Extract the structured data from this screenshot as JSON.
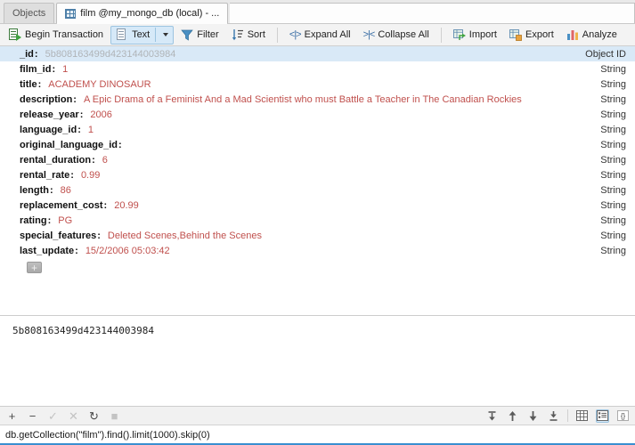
{
  "tabs": {
    "items": [
      {
        "label": "Objects",
        "icon": null,
        "active": false
      },
      {
        "label": "film @my_mongo_db (local) - ...",
        "icon": "table-icon",
        "active": true
      }
    ]
  },
  "toolbar": {
    "begin_transaction": "Begin Transaction",
    "text_mode": "Text",
    "filter": "Filter",
    "sort": "Sort",
    "expand_all": "Expand All",
    "collapse_all": "Collapse All",
    "import": "Import",
    "export": "Export",
    "analyze": "Analyze",
    "icons": {
      "begin_transaction": "transaction-icon",
      "text_mode": "document-text-icon",
      "text_dropdown": "chevron-down-icon",
      "filter": "funnel-icon",
      "sort": "sort-icon",
      "expand_all": "expand-all-icon",
      "collapse_all": "collapse-all-icon",
      "import": "import-icon",
      "export": "export-icon",
      "analyze": "bar-chart-icon"
    }
  },
  "document": {
    "columns": [
      "key",
      "value",
      "type"
    ],
    "rows": [
      {
        "key": "_id",
        "value": "5b808163499d423144003984",
        "type": "Object ID",
        "selected": true
      },
      {
        "key": "film_id",
        "value": "1",
        "type": "String",
        "selected": false
      },
      {
        "key": "title",
        "value": "ACADEMY DINOSAUR",
        "type": "String",
        "selected": false
      },
      {
        "key": "description",
        "value": "A Epic Drama of a Feminist And a Mad Scientist who must Battle a Teacher in The Canadian Rockies",
        "type": "String",
        "selected": false
      },
      {
        "key": "release_year",
        "value": "2006",
        "type": "String",
        "selected": false
      },
      {
        "key": "language_id",
        "value": "1",
        "type": "String",
        "selected": false
      },
      {
        "key": "original_language_id",
        "value": "",
        "type": "String",
        "selected": false
      },
      {
        "key": "rental_duration",
        "value": "6",
        "type": "String",
        "selected": false
      },
      {
        "key": "rental_rate",
        "value": "0.99",
        "type": "String",
        "selected": false
      },
      {
        "key": "length",
        "value": "86",
        "type": "String",
        "selected": false
      },
      {
        "key": "replacement_cost",
        "value": "20.99",
        "type": "String",
        "selected": false
      },
      {
        "key": "rating",
        "value": "PG",
        "type": "String",
        "selected": false
      },
      {
        "key": "special_features",
        "value": "Deleted Scenes,Behind the Scenes",
        "type": "String",
        "selected": false
      },
      {
        "key": "last_update",
        "value": "15/2/2006 05:03:42",
        "type": "String",
        "selected": false
      }
    ],
    "add_field_label": "+"
  },
  "value_viewer": {
    "content": "5b808163499d423144003984"
  },
  "record_bar": {
    "add": "+",
    "remove": "−",
    "confirm": "✓",
    "cancel": "✕",
    "refresh": "↻",
    "stop": "■",
    "nav_first": "first-record",
    "nav_prev": "previous-record",
    "nav_next": "next-record",
    "nav_last": "last-record",
    "view_grid": "grid-view",
    "view_tree": "tree-view",
    "view_json": "json-view",
    "active_view": "tree-view"
  },
  "query": {
    "text": "db.getCollection(\"film\").find().limit(1000).skip(0)"
  },
  "colors": {
    "accent": "#3a8fd0",
    "selection": "#d9e9f7",
    "value_text": "#c0504d",
    "tab_active_bg": "#fdfdfd"
  }
}
